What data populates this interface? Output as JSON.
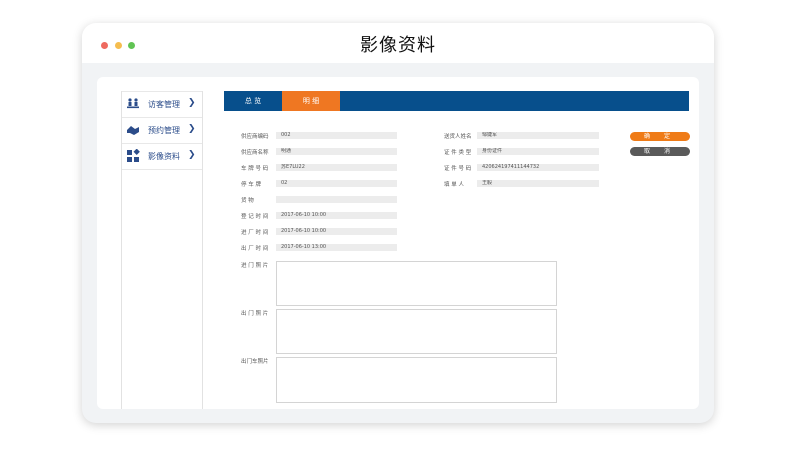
{
  "window": {
    "title": "影像资料"
  },
  "sidebar": {
    "items": [
      {
        "label": "访客管理",
        "icon": "visitor-icon"
      },
      {
        "label": "预约管理",
        "icon": "handshake-icon"
      },
      {
        "label": "影像资料",
        "icon": "grid-icon"
      }
    ]
  },
  "tabs": [
    {
      "label": "总 览",
      "active": false
    },
    {
      "label": "明 细",
      "active": true
    }
  ],
  "colors": {
    "primary": "#074f8c",
    "accent": "#ef7722",
    "dark_button": "#5a5a5a"
  },
  "form": {
    "supplier_code": {
      "label": "供应商编码",
      "value": "002"
    },
    "supplier_name": {
      "label": "供应商名称",
      "value": "明通"
    },
    "plate_no": {
      "label": "车 牌 号 码",
      "value": "苏E7LU22"
    },
    "parking_space": {
      "label": "停 车 牌",
      "value": "02"
    },
    "goods": {
      "label": "货 物",
      "value": ""
    },
    "register_time": {
      "label": "登 记 时 间",
      "value": "2017-06-10  10:00"
    },
    "entry_time": {
      "label": "进 厂 时 间",
      "value": "2017-06-10  10:00"
    },
    "exit_time": {
      "label": "出 厂 时 间",
      "value": "2017-06-10  13:00"
    },
    "driver_name": {
      "label": "送货人姓名",
      "value": "邹婕军"
    },
    "id_type": {
      "label": "证 件 类 型",
      "value": "身份证件"
    },
    "id_no": {
      "label": "证 件 号 码",
      "value": "420624197411144732"
    },
    "recorder": {
      "label": "填 单 人",
      "value": "王毅"
    },
    "entry_photo": {
      "label": "进 门 照 片"
    },
    "exit_photo": {
      "label": "出 门 照 片"
    },
    "exit_vehicle_photo": {
      "label": "出门车照片"
    }
  },
  "buttons": {
    "confirm": "确 定",
    "cancel": "取 消"
  }
}
